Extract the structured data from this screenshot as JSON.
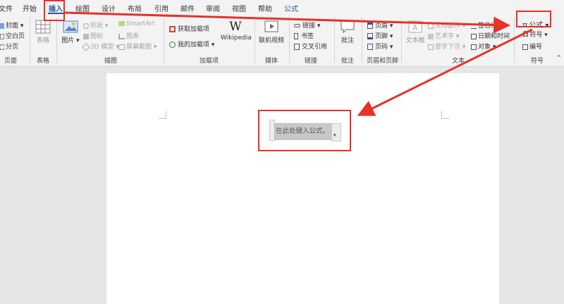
{
  "tabs": [
    "文件",
    "开始",
    "插入",
    "绘图",
    "设计",
    "布局",
    "引用",
    "邮件",
    "审阅",
    "视图",
    "帮助",
    "公式"
  ],
  "active_tab": "插入",
  "groups": {
    "pages": {
      "label": "页面",
      "items": [
        "封面",
        "空白页",
        "分页"
      ]
    },
    "tables": {
      "label": "表格",
      "items": [
        "表格"
      ]
    },
    "illustrations": {
      "label": "插图",
      "items": [
        "图片",
        "形状",
        "图标",
        "3D 模型",
        "SmartArt",
        "图表",
        "屏幕截图"
      ]
    },
    "addins": {
      "label": "加载项",
      "items": [
        "获取加载项",
        "我的加载项",
        "Wikipedia"
      ]
    },
    "media": {
      "label": "媒体",
      "items": [
        "联机视频"
      ]
    },
    "links": {
      "label": "链接",
      "items": [
        "链接",
        "书签",
        "交叉引用"
      ]
    },
    "comments": {
      "label": "批注",
      "items": [
        "批注"
      ]
    },
    "header_footer": {
      "label": "页眉和页脚",
      "items": [
        "页眉",
        "页脚",
        "页码"
      ]
    },
    "text": {
      "label": "文本",
      "items": [
        "文本框",
        "文档部件",
        "艺术字",
        "首字下沉",
        "签名行",
        "日期和时间",
        "对象"
      ]
    },
    "symbols": {
      "label": "符号",
      "items": [
        "公式",
        "符号",
        "编号"
      ]
    }
  },
  "document": {
    "equation_placeholder": "在此处键入公式。"
  },
  "colors": {
    "accent": "#2b579a",
    "annotation_red": "#e63228",
    "ribbon_bg": "#f3f3f3",
    "doc_bg": "#e6e6e6"
  },
  "icons": {
    "wikipedia": "W",
    "pi": "π",
    "omega": "Ω"
  }
}
